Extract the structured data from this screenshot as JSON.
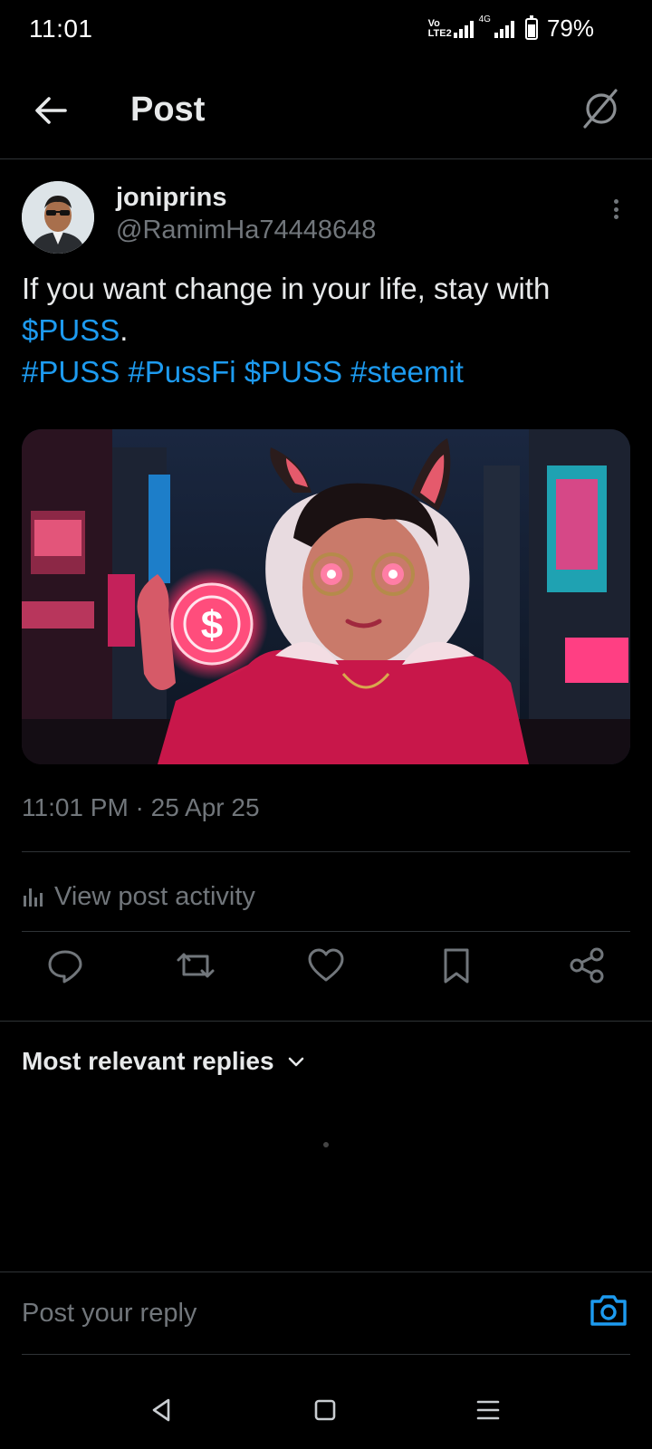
{
  "status_bar": {
    "time": "11:01",
    "volte": "Vo\nLTE2",
    "network": "4G",
    "battery_text": "79%",
    "battery_level": 0.79
  },
  "header": {
    "title": "Post"
  },
  "post": {
    "author_name": "joniprins",
    "author_handle": "@RamimHa74448648",
    "text_parts": {
      "line1": "If you want change in your life, stay with ",
      "cashtag1": "$PUSS",
      "period": ".",
      "hashtag1": "#PUSS",
      "hashtag2": "#PussFi",
      "cashtag2": "$PUSS",
      "hashtag3": "#steemit"
    },
    "timestamp": "11:01 PM · 25 Apr 25",
    "activity_label": "View post activity"
  },
  "replies": {
    "sort_label": "Most relevant replies"
  },
  "reply_box": {
    "placeholder": "Post your reply"
  },
  "icons": {
    "back": "arrow-left-icon",
    "grok": "grok-icon",
    "more": "more-vertical-icon",
    "reply": "comment-icon",
    "repost": "repost-icon",
    "like": "heart-icon",
    "bookmark": "bookmark-icon",
    "share": "share-icon",
    "camera": "camera-icon"
  },
  "colors": {
    "background": "#000000",
    "text": "#e7e9ea",
    "muted": "#71767b",
    "link": "#1d9bf0",
    "divider": "#2f3336"
  }
}
